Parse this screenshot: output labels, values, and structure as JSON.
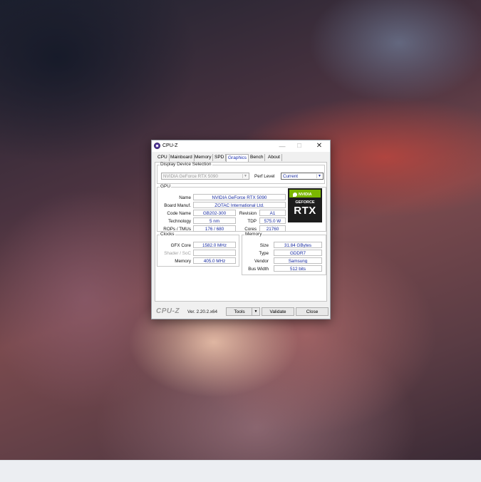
{
  "window": {
    "title": "CPU-Z",
    "controls": {
      "minimize": "—",
      "maximize": "☐",
      "close": "✕"
    }
  },
  "tabs": [
    {
      "label": "CPU",
      "active": false
    },
    {
      "label": "Mainboard",
      "active": false
    },
    {
      "label": "Memory",
      "active": false
    },
    {
      "label": "SPD",
      "active": false
    },
    {
      "label": "Graphics",
      "active": true
    },
    {
      "label": "Bench",
      "active": false
    },
    {
      "label": "About",
      "active": false
    }
  ],
  "display_selection": {
    "legend": "Display Device Selection",
    "device": "NVIDIA GeForce RTX 5090",
    "perf_label": "Perf Level",
    "perf_value": "Current"
  },
  "gpu": {
    "legend": "GPU",
    "name_label": "Name",
    "name": "NVIDIA GeForce RTX 5090",
    "board_label": "Board Manuf.",
    "board": "ZOTAC International Ltd.",
    "code_label": "Code Name",
    "code": "GB202-300",
    "revision_label": "Revision",
    "revision": "A1",
    "tech_label": "Technology",
    "tech": "5 nm",
    "tdp_label": "TDP",
    "tdp": "575.0 W",
    "rops_label": "ROPs / TMUs",
    "rops": "176 / 680",
    "cores_label": "Cores",
    "cores": "21760",
    "logo": {
      "brand": "NVIDIA",
      "line1": "GEFORCE",
      "line2": "RTX",
      "icon": "nvidia-eye-icon",
      "accent": "#76b900"
    }
  },
  "clocks": {
    "legend": "Clocks",
    "gfx_label": "GFX Core",
    "gfx": "1582.0 MHz",
    "shader_label": "Shader / SoC",
    "shader": "",
    "memory_label": "Memory",
    "memory": "405.0 MHz"
  },
  "memory": {
    "legend": "Memory",
    "size_label": "Size",
    "size": "31.84 GBytes",
    "type_label": "Type",
    "type": "GDDR7",
    "vendor_label": "Vendor",
    "vendor": "Samsung",
    "bus_label": "Bus Width",
    "bus": "512 bits"
  },
  "footer": {
    "brand": "CPU-Z",
    "version": "Ver. 2.20.2.x64",
    "tools": "Tools",
    "validate": "Validate",
    "close": "Close"
  },
  "colors": {
    "value_text": "#1428a0",
    "active_tab": "#1a2fb0"
  }
}
